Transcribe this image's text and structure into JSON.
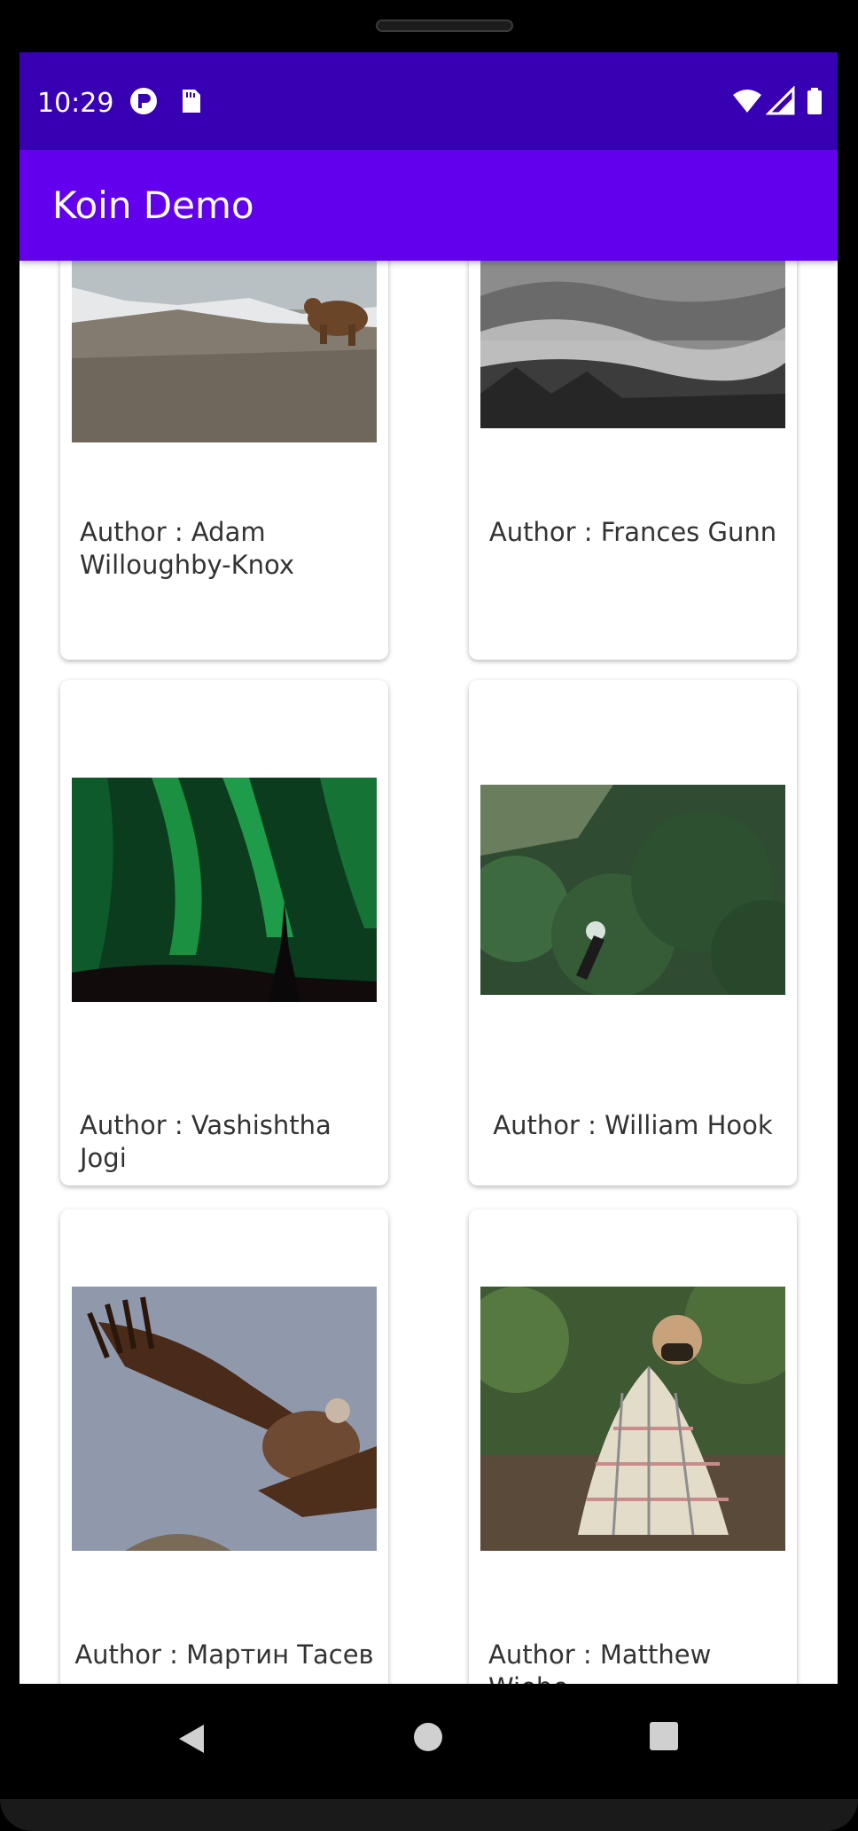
{
  "status_bar": {
    "time": "10:29",
    "left_icons": [
      "tracking-icon",
      "sd-card-icon"
    ],
    "right_icons": [
      "wifi-icon",
      "signal-icon",
      "battery-icon"
    ],
    "color": "#3700b3"
  },
  "app_bar": {
    "title": "Koin Demo",
    "color": "#6200ee"
  },
  "photos": [
    {
      "author": "Author : Adam Willoughby-Knox",
      "image": "bear-on-rocky-slope"
    },
    {
      "author": "Author : Frances Gunn",
      "image": "misty-forest-hills"
    },
    {
      "author": "Author : Vashishtha Jogi",
      "image": "northern-lights"
    },
    {
      "author": "Author : William Hook",
      "image": "mountain-biker-in-forest"
    },
    {
      "author": "Author : Мартин Тасев",
      "image": "vulture-in-flight"
    },
    {
      "author": "Author : Matthew Wiebe",
      "image": "pug-in-blanket"
    }
  ],
  "nav_bar": {
    "buttons": [
      "back-icon",
      "home-icon",
      "recents-icon"
    ]
  }
}
